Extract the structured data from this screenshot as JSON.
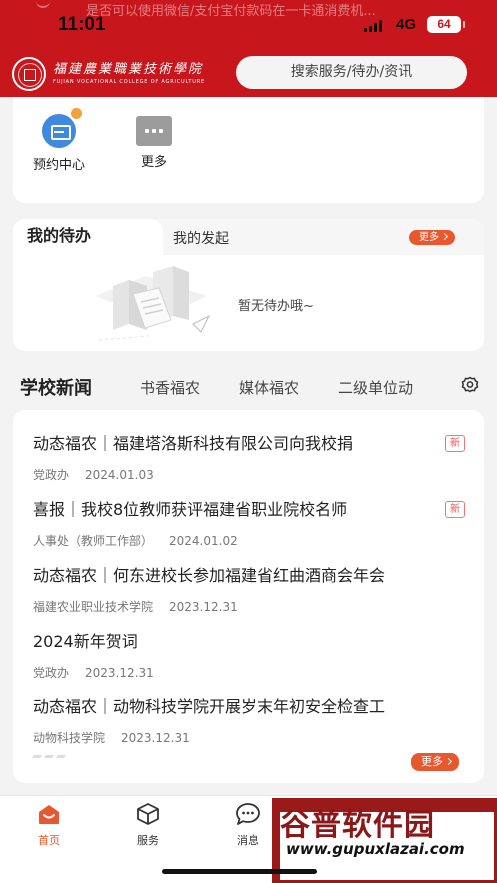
{
  "status_bar": {
    "time": "11:01",
    "network": "4G",
    "battery": "64",
    "ghost_notice": "是否可以使用微信/支付宝付款码在一卡通消费机..."
  },
  "header": {
    "logo_cn": "福建農業職業技術學院",
    "logo_en": "FUJIAN VOCATIONAL COLLEGE OF AGRICULTURE",
    "search_placeholder": "搜索服务/待办/资讯"
  },
  "quick_actions": [
    {
      "label": "预约中心",
      "icon": "sofa-icon"
    },
    {
      "label": "更多",
      "icon": "more-grid-icon"
    }
  ],
  "todo": {
    "tab_active": "我的待办",
    "tab_other": "我的发起",
    "more": "更多",
    "empty_text": "暂无待办哦~"
  },
  "news": {
    "title": "学校新闻",
    "tabs": [
      "书香福农",
      "媒体福农",
      "二级单位动"
    ],
    "items": [
      {
        "headline": "动态福农｜福建塔洛斯科技有限公司向我校捐",
        "source": "党政办",
        "date": "2024.01.03",
        "new": "新"
      },
      {
        "headline": "喜报｜我校8位教师获评福建省职业院校名师",
        "source": "人事处（教师工作部）",
        "date": "2024.01.02",
        "new": "新"
      },
      {
        "headline": "动态福农｜何东进校长参加福建省红曲酒商会年会",
        "source": "福建农业职业技术学院",
        "date": "2023.12.31",
        "new": ""
      },
      {
        "headline": "2024新年贺词",
        "source": "党政办",
        "date": "2023.12.31",
        "new": ""
      },
      {
        "headline": "动态福农｜动物科技学院开展岁末年初安全检查工",
        "source": "动物科技学院",
        "date": "2023.12.31",
        "new": ""
      }
    ],
    "more": "更多"
  },
  "tabbar": {
    "items": [
      {
        "label": "首页",
        "icon": "home-icon",
        "active": true
      },
      {
        "label": "服务",
        "icon": "cube-icon",
        "active": false
      },
      {
        "label": "消息",
        "icon": "chat-bubble-icon",
        "active": false
      }
    ]
  },
  "watermark": {
    "title": "谷普软件园",
    "url": "www.gupuxlazai.com"
  },
  "colors": {
    "brand_red": "#c8161d",
    "accent_orange": "#e8582e",
    "icon_blue": "#3f8ae0"
  }
}
